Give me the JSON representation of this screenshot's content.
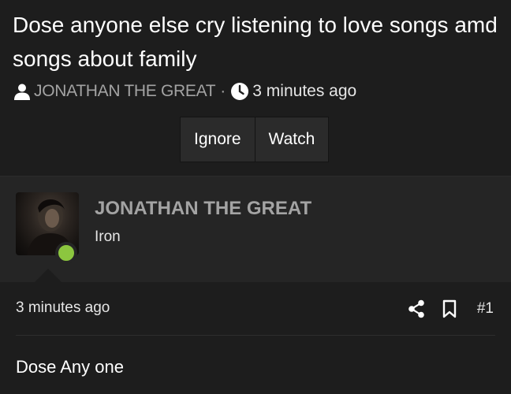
{
  "thread": {
    "title": "Dose anyone else cry listening to love songs amd songs about family",
    "author": "JONATHAN THE GREAT",
    "separator": "·",
    "time": "3 minutes ago"
  },
  "actions": {
    "ignore_label": "Ignore",
    "watch_label": "Watch"
  },
  "post": {
    "username": "JONATHAN THE GREAT",
    "user_title": "Iron",
    "online_color": "#8cc63f",
    "time": "3 minutes ago",
    "number": "#1",
    "message": "Dose Any one"
  },
  "icons": {
    "user": "user-icon",
    "clock": "clock-icon",
    "share": "share-icon",
    "bookmark": "bookmark-icon"
  }
}
